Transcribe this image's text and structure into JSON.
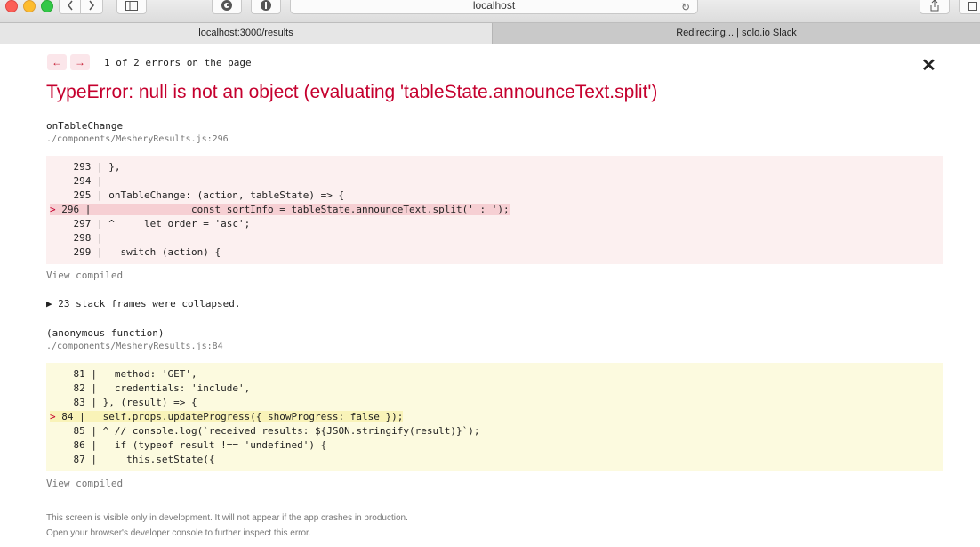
{
  "browser": {
    "address": "localhost",
    "tabs": [
      {
        "label": "localhost:3000/results",
        "active": true
      },
      {
        "label": "Redirecting... | solo.io Slack",
        "active": false
      }
    ]
  },
  "overlay": {
    "error_count": "1 of 2 errors on the page",
    "title": "TypeError: null is not an object (evaluating 'tableState.announceText.split')",
    "frame1": {
      "function": "onTableChange",
      "file": "./components/MesheryResults.js:296",
      "lines": [
        {
          "n": "293",
          "code": "},"
        },
        {
          "n": "294",
          "code": ""
        },
        {
          "n": "295",
          "code": "onTableChange: (action, tableState) => {"
        },
        {
          "n": "296",
          "code": "                const sortInfo = tableState.announceText.split(' : ');",
          "highlight": true
        },
        {
          "n": "297",
          "code": "^     let order = 'asc';"
        },
        {
          "n": "298",
          "code": ""
        },
        {
          "n": "299",
          "code": "  switch (action) {"
        }
      ],
      "view_compiled": "View compiled"
    },
    "collapsed": "23 stack frames were collapsed.",
    "frame2": {
      "function": "(anonymous function)",
      "file": "./components/MesheryResults.js:84",
      "lines": [
        {
          "n": "81",
          "code": "  method: 'GET',"
        },
        {
          "n": "82",
          "code": "  credentials: 'include',"
        },
        {
          "n": "83",
          "code": "}, (result) => {"
        },
        {
          "n": "84",
          "code": "  self.props.updateProgress({ showProgress: false });",
          "highlight": true
        },
        {
          "n": "85",
          "code": "^ // console.log(`received results: ${JSON.stringify(result)}`);"
        },
        {
          "n": "86",
          "code": "  if (typeof result !== 'undefined') {"
        },
        {
          "n": "87",
          "code": "    this.setState({"
        }
      ],
      "view_compiled": "View compiled"
    },
    "footer_line1": "This screen is visible only in development. It will not appear if the app crashes in production.",
    "footer_line2": "Open your browser's developer console to further inspect this error."
  },
  "colors": {
    "error_red": "#c5002e",
    "code_red_bg": "#fcf0f0",
    "code_yellow_bg": "#fcfadf"
  }
}
